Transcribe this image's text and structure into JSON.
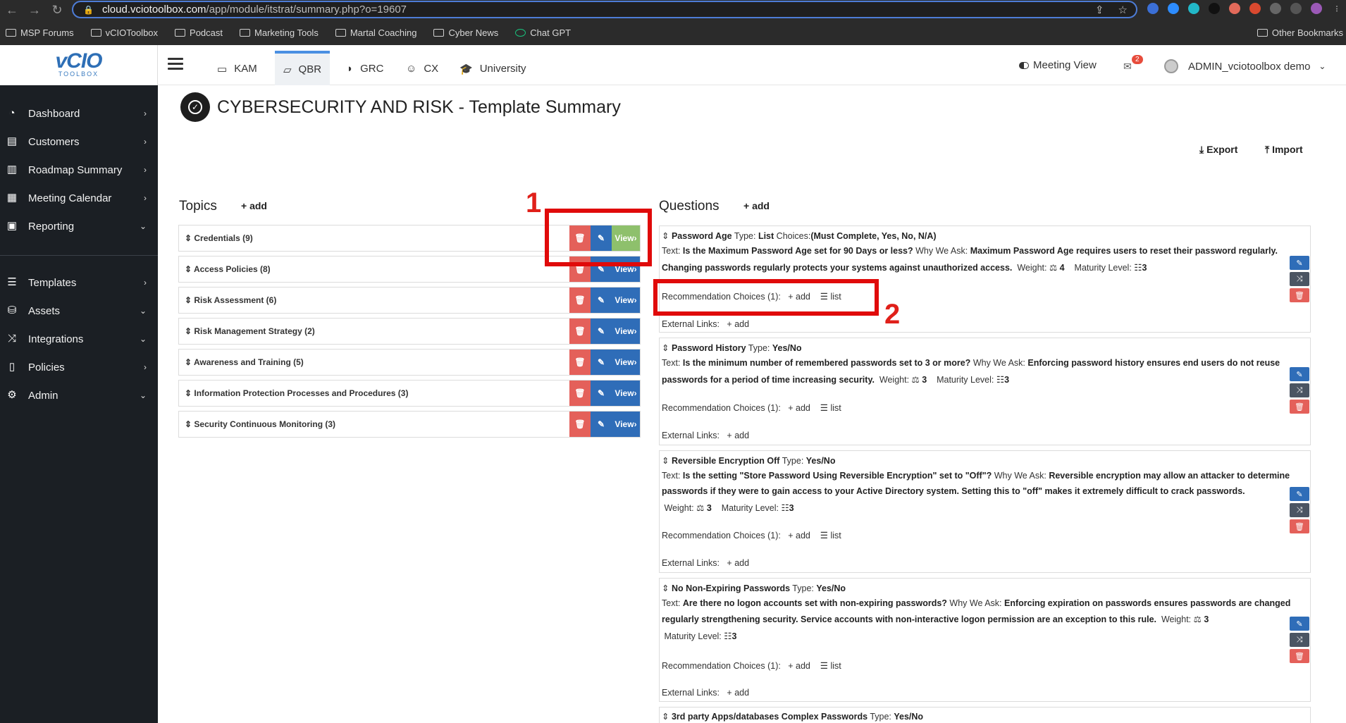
{
  "browser": {
    "url_host": "cloud.vciotoolbox.com",
    "url_path": "/app/module/itstrat/summary.php?o=19607",
    "bookmarks": [
      "MSP Forums",
      "vCIOToolbox",
      "Podcast",
      "Marketing Tools",
      "Martal Coaching",
      "Cyber News",
      "Chat GPT"
    ],
    "other_bookmarks": "Other Bookmarks"
  },
  "logo": {
    "main": "vCIO",
    "sub": "TOOLBOX"
  },
  "sidebar": {
    "items": [
      {
        "label": "Dashboard",
        "icon": "dashboard-icon",
        "chevron": "›"
      },
      {
        "label": "Customers",
        "icon": "customers-icon",
        "chevron": "›"
      },
      {
        "label": "Roadmap Summary",
        "icon": "map-icon",
        "chevron": "›"
      },
      {
        "label": "Meeting Calendar",
        "icon": "calendar-icon",
        "chevron": "›"
      },
      {
        "label": "Reporting",
        "icon": "reporting-icon",
        "chevron": "⌄"
      },
      {
        "label": "Templates",
        "icon": "templates-icon",
        "chevron": "›"
      },
      {
        "label": "Assets",
        "icon": "assets-icon",
        "chevron": "⌄"
      },
      {
        "label": "Integrations",
        "icon": "integrations-icon",
        "chevron": "⌄"
      },
      {
        "label": "Policies",
        "icon": "policies-icon",
        "chevron": "›"
      },
      {
        "label": "Admin",
        "icon": "admin-icon",
        "chevron": "⌄"
      }
    ]
  },
  "topnav": {
    "tabs": [
      {
        "label": "KAM",
        "icon": "id-card-icon"
      },
      {
        "label": "QBR",
        "icon": "laptop-icon"
      },
      {
        "label": "GRC",
        "icon": "shield-icon"
      },
      {
        "label": "CX",
        "icon": "smile-icon"
      },
      {
        "label": "University",
        "icon": "graduation-cap-icon"
      }
    ],
    "meeting_view": "Meeting View",
    "mail_count": "2",
    "user": "ADMIN_vciotoolbox demo"
  },
  "page": {
    "title": "CYBERSECURITY AND RISK - Template Summary",
    "export": "Export",
    "import": "Import"
  },
  "topics": {
    "heading": "Topics",
    "add": "add",
    "view_label": "View",
    "items": [
      {
        "label": "Credentials (9)"
      },
      {
        "label": "Access Policies (8)"
      },
      {
        "label": "Risk Assessment (6)"
      },
      {
        "label": "Risk Management Strategy (2)"
      },
      {
        "label": "Awareness and Training (5)"
      },
      {
        "label": "Information Protection Processes and Procedures (3)"
      },
      {
        "label": "Security Continuous Monitoring (3)"
      }
    ]
  },
  "questions": {
    "heading": "Questions",
    "add": "add",
    "rec_label": "Recommendation Choices (1):",
    "rec_add": "add",
    "rec_list": "list",
    "ext_label": "External Links:",
    "ext_add": "add",
    "items": [
      {
        "name": "Password Age",
        "type_label": "Type:",
        "type": "List",
        "choices_label": "Choices:",
        "choices": "(Must Complete, Yes, No, N/A)",
        "text_label": "Text:",
        "text": "Is the Maximum Password Age set for 90 Days or less?",
        "why_label": "Why We Ask:",
        "why_1": "Maximum Password Age requires users to reset their password regularly.",
        "why_2": "Changing passwords regularly protects your systems against unauthorized access.",
        "weight_label": "Weight:",
        "weight": "4",
        "maturity_label": "Maturity Level:",
        "maturity": "3"
      },
      {
        "name": "Password History",
        "type_label": "Type:",
        "type": "Yes/No",
        "text_label": "Text:",
        "text": "Is the minimum number of remembered passwords set to 3 or more?",
        "why_label": "Why We Ask:",
        "why_1": "Enforcing password history ensures end users do not reuse",
        "why_2": "passwords for a period of time increasing security.",
        "weight_label": "Weight:",
        "weight": "3",
        "maturity_label": "Maturity Level:",
        "maturity": "3"
      },
      {
        "name": "Reversible Encryption Off",
        "type_label": "Type:",
        "type": "Yes/No",
        "text_label": "Text:",
        "text": "Is the setting \"Store Password Using Reversible Encryption\" set to \"Off\"?",
        "why_label": "Why We Ask:",
        "why_1": "Reversible encryption may allow an attacker to determine",
        "why_2": "passwords if they were to gain access to your Active Directory system. Setting this to \"off\" makes it extremely difficult to crack passwords.",
        "weight_label": "Weight:",
        "weight": "3",
        "maturity_label": "Maturity Level:",
        "maturity": "3"
      },
      {
        "name": "No Non-Expiring Passwords",
        "type_label": "Type:",
        "type": "Yes/No",
        "text_label": "Text:",
        "text": "Are there no logon accounts set with non-expiring passwords?",
        "why_label": "Why We Ask:",
        "why_1": "Enforcing expiration on passwords ensures passwords are changed",
        "why_2": "regularly strengthening security. Service accounts with non-interactive logon permission are an exception to this rule.",
        "weight_label": "Weight:",
        "weight": "3",
        "maturity_label": "Maturity Level:",
        "maturity": "3"
      },
      {
        "name": "3rd party Apps/databases Complex Passwords",
        "type_label": "Type:",
        "type": "Yes/No"
      }
    ]
  },
  "annotations": {
    "one": "1",
    "two": "2",
    "color": "#e00a0a"
  }
}
